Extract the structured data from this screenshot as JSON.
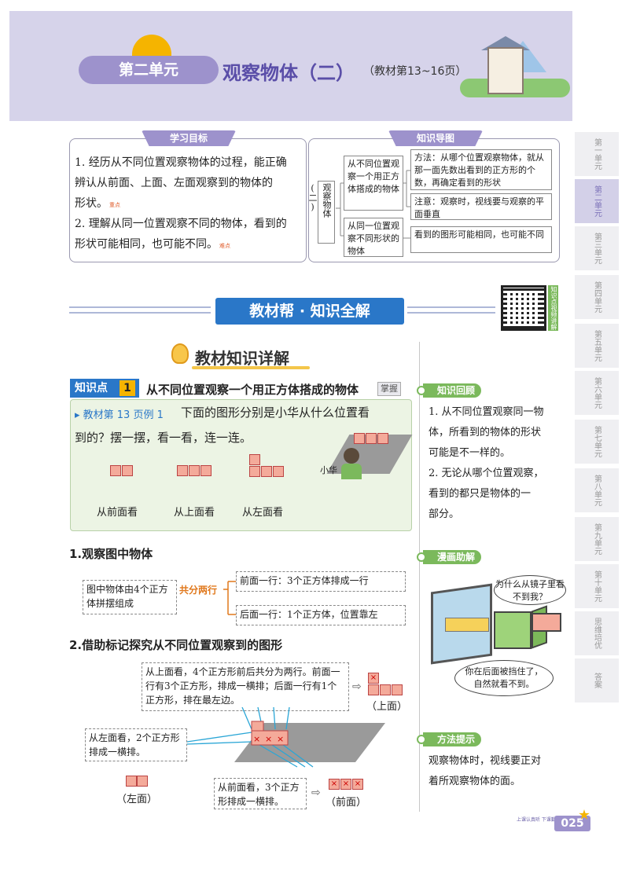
{
  "header": {
    "unit_label": "第二单元",
    "title": "观察物体（二）",
    "subtitle": "（教材第13~16页）"
  },
  "side_tabs": [
    "第一单元",
    "第二单元",
    "第三单元",
    "第四单元",
    "第五单元",
    "第六单元",
    "第七单元",
    "第八单元",
    "第九单元",
    "第十单元",
    "思维培优",
    "答案"
  ],
  "goals": {
    "heading": "学习目标",
    "items": [
      {
        "lines": [
          "1. 经历从不同位置观察物体的过程，能正确",
          "辨认从前面、上面、左面观察到的物体的",
          "形状。"
        ],
        "badge": "重点"
      },
      {
        "lines": [
          "2. 理解从同一位置观察不同的物体，看到的",
          "形状可能相同，也可能不同。"
        ],
        "badge": "难点"
      }
    ]
  },
  "knowledge_map": {
    "heading": "知识导图",
    "root": "观察物体(二)",
    "branch1": "从不同位置观察一个用正方体搭成的物体",
    "leaf1": "方法：从哪个位置观察物体，就从那一面先数出看到的正方形的个数，再确定看到的形状",
    "leaf2": "注意：观察时，视线要与观察的平面垂直",
    "branch2": "从同一位置观察不同形状的物体",
    "leaf3": "看到的图形可能相同，也可能不同"
  },
  "banner": {
    "title": "教材帮 · 知识全解",
    "qr_label": "知识点视频讲解"
  },
  "section": {
    "title": "教材知识详解"
  },
  "knowledge_point": {
    "label": "知识点",
    "number": "1",
    "title": "从不同位置观察一个用正方体搭成的物体",
    "tag": "掌握"
  },
  "example": {
    "ref": "▸ 教材第 13 页例 1",
    "question_line1": "下面的图形分别是小华从什么位置看",
    "question_line2": "到的？摆一摆，看一看，连一连。",
    "views": [
      "从前面看",
      "从上面看",
      "从左面看"
    ],
    "person": "小华"
  },
  "part1": {
    "heading": "1.观察图中物体",
    "left": "图中物体由4个正方体拼摆组成",
    "connector": "共分两行",
    "row1": "前面一行：3个正方体排成一行",
    "row2": "后面一行：1个正方体，位置靠左"
  },
  "part2": {
    "heading": "2.借助标记探究从不同位置观察到的图形",
    "top_note": "从上面看，4个正方形前后共分为两行。前面一行有3个正方形，排成一横排；后面一行有1个正方形，排在最左边。",
    "top_label": "（上面）",
    "left_note": "从左面看，2个正方形排成一横排。",
    "left_label": "（左面）",
    "front_note": "从前面看，3个正方形排成一横排。",
    "front_label": "（前面）"
  },
  "sidebar": {
    "review": {
      "tag": "知识回顾",
      "lines": [
        "1. 从不同位置观察同一物",
        "体，所看到的物体的形状",
        "可能是不一样的。",
        "2. 无论从哪个位置观察，",
        "看到的都只是物体的一",
        "部分。"
      ]
    },
    "comic": {
      "tag": "漫画助解",
      "bubble1": "为什么从镜子里看不到我？",
      "bubble2": "你在后面被挡住了，自然就看不到。"
    },
    "tip": {
      "tag": "方法提示",
      "lines": [
        "观察物体时，视线要正对",
        "着所观察物体的面。"
      ]
    }
  },
  "footer": {
    "page_number": "025",
    "small": "上课认真听 下课勤思考"
  },
  "colors": {
    "purple": "#9d92cc",
    "blue": "#2a77c8",
    "green": "#7bb95c",
    "orange": "#e0781c",
    "square": "#f4aa9a"
  }
}
